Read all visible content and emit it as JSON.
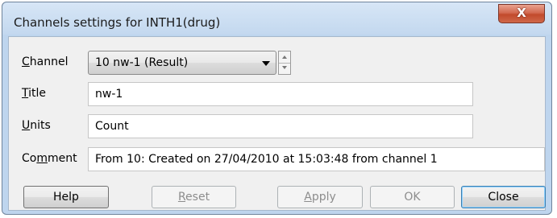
{
  "window": {
    "title": "Channels settings for INTH1(drug)",
    "close_label": "X"
  },
  "form": {
    "channel": {
      "label_ul": "C",
      "label_rest": "hannel",
      "value": "10 nw-1 (Result)"
    },
    "title": {
      "label_ul": "T",
      "label_rest": "itle",
      "value": "nw-1"
    },
    "units": {
      "label_ul": "U",
      "label_rest": "nits",
      "value": "Count"
    },
    "comment": {
      "label_pre": "Co",
      "label_ul": "m",
      "label_rest": "ment",
      "value": "From 10: Created on 27/04/2010 at 15:03:48 from channel 1"
    }
  },
  "buttons": {
    "help": "Help",
    "reset_ul": "R",
    "reset_rest": "eset",
    "apply_ul": "A",
    "apply_rest": "pply",
    "ok": "OK",
    "close": "Close"
  }
}
